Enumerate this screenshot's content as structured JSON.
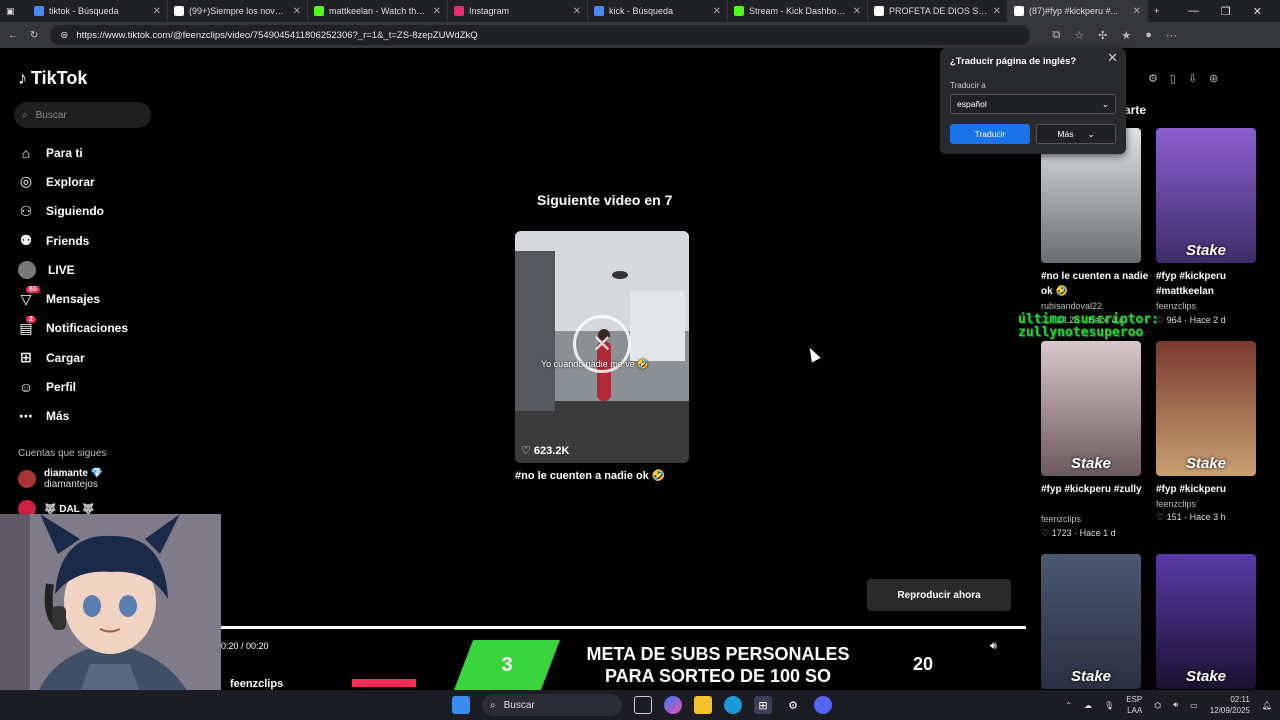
{
  "browser": {
    "tabs": [
      {
        "title": "tiktok - Búsqueda",
        "color": "#4c8bf5"
      },
      {
        "title": "(99+)Siempre los novelero...",
        "color": "#ffffff"
      },
      {
        "title": "mattkeelan - Watch the VO...",
        "color": "#53fc18"
      },
      {
        "title": "Instagram",
        "color": "#e1306c"
      },
      {
        "title": "kick - Búsqueda",
        "color": "#4c8bf5"
      },
      {
        "title": "Stream - Kick Dashboa...",
        "color": "#53fc18"
      },
      {
        "title": "PROFETA DE DIOS SIENPRE...",
        "color": "#ffffff"
      },
      {
        "title": "(87)#fyp #kickperu #...",
        "color": "#ffffff"
      }
    ],
    "new_tab": "+",
    "url": "https://www.tiktok.com/@feenzclips/video/7549045411806252306?_r=1&_t=ZS-8zepZUWdZkQ"
  },
  "sidebar": {
    "logo": "TikTok",
    "search_placeholder": "Buscar",
    "items": [
      {
        "label": "Para ti",
        "icon": "home-icon"
      },
      {
        "label": "Explorar",
        "icon": "compass-icon"
      },
      {
        "label": "Siguiendo",
        "icon": "following-icon"
      },
      {
        "label": "Friends",
        "icon": "friends-icon"
      },
      {
        "label": "LIVE",
        "icon": "live-icon"
      },
      {
        "label": "Mensajes",
        "icon": "messages-icon",
        "badge": "65"
      },
      {
        "label": "Notificaciones",
        "icon": "notifications-icon",
        "badge": "2"
      },
      {
        "label": "Cargar",
        "icon": "upload-icon"
      },
      {
        "label": "Perfil",
        "icon": "profile-icon"
      },
      {
        "label": "Más",
        "icon": "more-icon"
      }
    ],
    "following_title": "Cuentas que sigues",
    "following": [
      {
        "name": "diamante 💎",
        "handle": "diamantejos"
      },
      {
        "name": "🐺 DAL 🐺",
        "handle": ""
      }
    ]
  },
  "main": {
    "next_title": "Siguiente video en 7",
    "thumb_caption": "Yo cuando nadie me ve 🤣",
    "likes": "623.2K",
    "next_caption": "#no le cuenten a nadie ok 🤣",
    "play_now": "Reproducir ahora",
    "time": "0:20 / 00:20",
    "author_peek": "feenzclips"
  },
  "banner": {
    "current": "3",
    "text_line1": "META DE SUBS PERSONALES",
    "text_line2": "PARA SORTEO DE 100 SO",
    "goal": "20"
  },
  "right": {
    "title": "arte",
    "overlay_line1": "último suscriptor:",
    "overlay_line2": "zullynotesuperoo",
    "cards": [
      {
        "caption": "#no le cuenten a nadie ok 🤣",
        "author": "rubisandoval22",
        "stats": "♡ 623.2K · Hace 4 d",
        "stake": ""
      },
      {
        "caption": "#fyp #kickperu #mattkeelan",
        "author": "feenzclips",
        "stats": "♡ 964 · Hace 2 d",
        "stake": "Stake"
      },
      {
        "caption": "#fyp #kickperu #zully",
        "author": "feenzclips",
        "stats": "♡ 1723 · Hace 1 d",
        "stake": "Stake"
      },
      {
        "caption": "#fyp #kickperu",
        "author": "feenzclips",
        "stats": "♡ 151 · Hace 3 h",
        "stake": "Stake"
      },
      {
        "caption": "",
        "author": "",
        "stats": "",
        "stake": "Stake"
      },
      {
        "caption": "",
        "author": "",
        "stats": "",
        "stake": "Stake"
      }
    ]
  },
  "translate": {
    "title": "¿Traducir página de inglés?",
    "label": "Traducir a",
    "language": "español",
    "translate_btn": "Traducir",
    "more_btn": "Más"
  },
  "taskbar": {
    "search": "Buscar",
    "lang1": "ESP",
    "lang2": "LAA",
    "time": "02:11",
    "date": "12/09/2025"
  }
}
